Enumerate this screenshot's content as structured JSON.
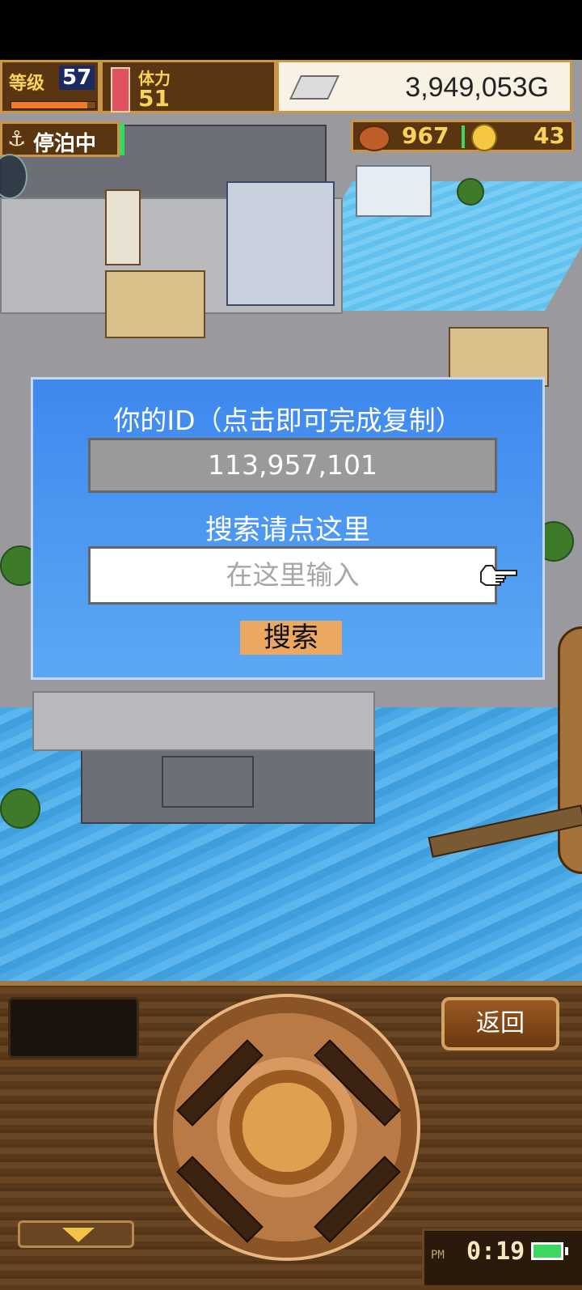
{
  "hud": {
    "level_label": "等级",
    "level_value": "57",
    "stamina_label": "体力",
    "stamina_value": "51",
    "gold_value": "3,949,053G",
    "docked_status": "停泊中",
    "resource_1_value": "967",
    "resource_2_value": "43"
  },
  "dialog": {
    "title": "你的ID（点击即可完成复制）",
    "id_value": "113,957,101",
    "search_label": "搜索请点这里",
    "input_placeholder": "在这里输入",
    "search_button": "搜索"
  },
  "controls": {
    "back_button": "返回",
    "clock_ampm": "PM",
    "clock_time": "0:19",
    "battery_level": 1.0
  },
  "icons": [
    "anchor-icon",
    "ingot-icon",
    "food-icon",
    "coin-icon",
    "pointing-hand-icon",
    "down-arrow-icon",
    "battery-icon"
  ],
  "colors": {
    "dialog_top": "#3e88ee",
    "dialog_bottom": "#5aa8f4",
    "search_button": "#eca860",
    "hud_gold_text": "#f7d35b",
    "battery": "#3dd65f"
  }
}
